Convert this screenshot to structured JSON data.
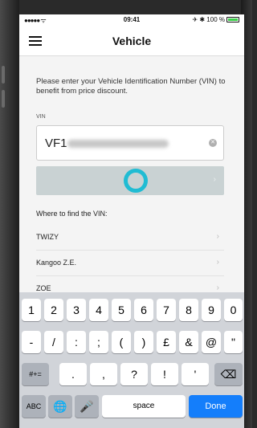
{
  "status_bar": {
    "signal": "●●●●● ᯤ",
    "time": "09:41",
    "battery_text": "✈ ✱ 100 %",
    "battery_color": "#3bd14a"
  },
  "navbar": {
    "title": "Vehicle",
    "menu_icon": "hamburger-icon"
  },
  "form": {
    "instruction": "Please enter your Vehicle Identification Number (VIN) to benefit from price discount.",
    "vin_label": "VIN",
    "vin_value": "VF1",
    "clear_icon": "clear-circle-icon"
  },
  "submit": {
    "chevron": "›",
    "touch_indicator_color": "#20bcd3"
  },
  "where": {
    "label": "Where to find the VIN:",
    "models": [
      {
        "name": "TWIZY"
      },
      {
        "name": "Kangoo Z.E."
      },
      {
        "name": "ZOE"
      }
    ]
  },
  "keyboard": {
    "row1": [
      "1",
      "2",
      "3",
      "4",
      "5",
      "6",
      "7",
      "8",
      "9",
      "0"
    ],
    "row2": [
      "-",
      "/",
      ":",
      ";",
      "(",
      ")",
      "£",
      "&",
      "@",
      "\""
    ],
    "row3": [
      "#+=",
      ".",
      ",",
      "?",
      "!",
      "'",
      "⌫"
    ],
    "row4": [
      "ABC",
      "🌐",
      "🎤",
      "space",
      "Done"
    ],
    "accent_color": "#147efb"
  }
}
